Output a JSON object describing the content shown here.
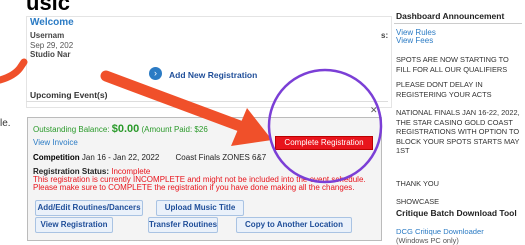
{
  "header": {
    "title": "usic"
  },
  "profile": {
    "welcome": "Welcome",
    "username_label": "Usernam",
    "date": "Sep 29, 202",
    "studio_label": "Studio Nar",
    "colon": "s:"
  },
  "actions": {
    "add_new": "Add New Registration"
  },
  "upcoming": {
    "title": "Upcoming Event(s)",
    "fragment": "le."
  },
  "event": {
    "outstanding_label": "Outstanding Balance:",
    "outstanding_value": "$0.00",
    "amount_paid": "(Amount Paid: $26",
    "view_invoice": "View Invoice",
    "competition_label": "Competition",
    "competition_dates": "Jan 16 - Jan 22, 2022",
    "competition_name": "Coast Finals ZONES 6&7",
    "complete_registration": "Complete Registration",
    "status_label": "Registration Status:",
    "status_value": "Incomplete",
    "warning_1": "This registration is currently INCOMPLETE and might not be included into the event schedule.",
    "warning_2": "Please make sure to COMPLETE the registration if you have done making all the changes.",
    "buttons": {
      "add_edit": "Add/Edit Routines/Dancers",
      "upload_music": "Upload Music Title",
      "view_registration": "View Registration",
      "transfer": "Transfer Routines",
      "copy": "Copy to Another Location"
    }
  },
  "sidebar": {
    "title": "Dashboard Announcement",
    "view_rules": "View Rules",
    "view_fees": "View Fees",
    "ann1": "SPOTS ARE NOW STARTING TO FILL FOR ALL OUR QUALIFIERS",
    "ann2": "PLEASE DONT DELAY IN REGISTERING YOUR ACTS",
    "ann3": "NATIONAL FINALS JAN 16-22, 2022, THE STAR CASINO GOLD COAST REGISTRATIONS WITH OPTION TO BLOCK YOUR SPOTS STARTS MAY 1ST",
    "ann4": "THANK YOU",
    "ann5": "SHOWCASE",
    "critique_title": "Critique Batch Download Tool",
    "critique_link": "DCG Critique Downloader",
    "critique_sub": "(Windows PC only)"
  },
  "colors": {
    "accent": "#2b7bc4",
    "alert": "#e8141c",
    "arrow": "#f0502a",
    "circle": "#7b3fd6"
  }
}
